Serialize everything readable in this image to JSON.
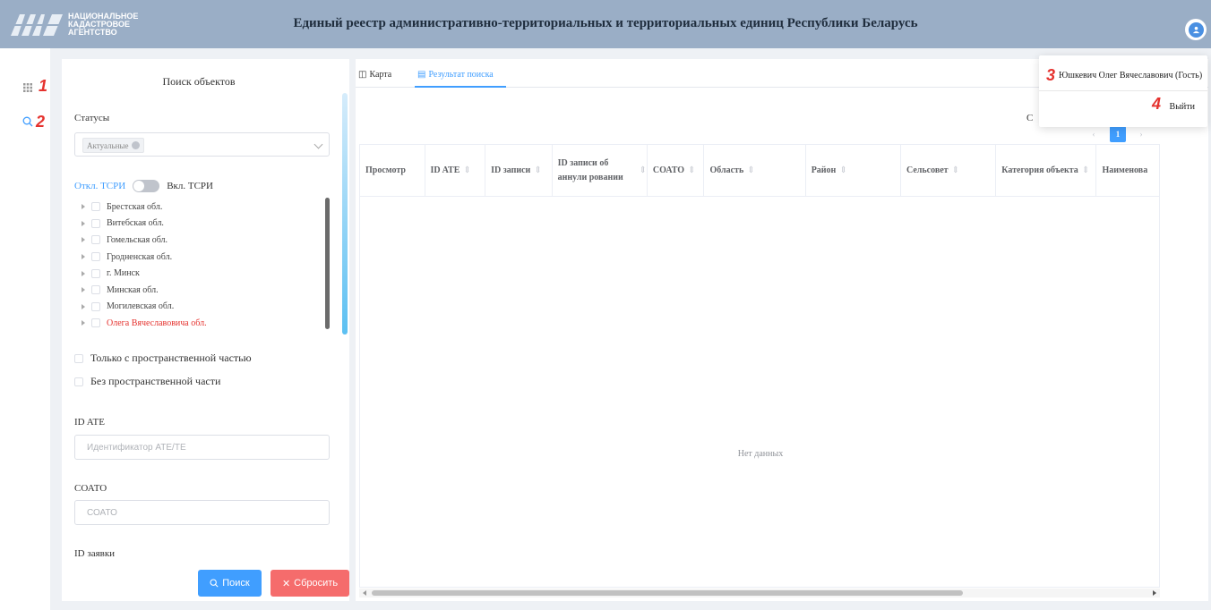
{
  "header": {
    "logo_lines": [
      "НАЦИОНАЛЬНОЕ",
      "КАДАСТРОВОЕ",
      "АГЕНТСТВО"
    ],
    "title": "Единый реестр административно-территориальных и территориальных единиц Республики Беларусь"
  },
  "rail": {
    "items": [
      {
        "icon": "grid-icon",
        "badge": "1"
      },
      {
        "icon": "search-icon",
        "badge": "2"
      }
    ]
  },
  "search_panel": {
    "title": "Поиск объектов",
    "statuses_label": "Статусы",
    "status_tag": "Актуальные",
    "tsr_off": "Откл. ТСРИ",
    "tsr_on": "Вкл. ТСРИ",
    "regions": [
      "Брестская обл.",
      "Витебская обл.",
      "Гомельская обл.",
      "Гродненская обл.",
      "г. Минск",
      "Минская обл.",
      "Могилевская обл.",
      "Олега Вячеславовича обл."
    ],
    "only_spatial": "Только с пространственной частью",
    "without_spatial": "Без пространственной части",
    "id_ate_label": "ID ATE",
    "id_ate_placeholder": "Идентификатор АТЕ/ТЕ",
    "soato_label": "СОАТО",
    "soato_placeholder": "СОАТО",
    "id_request_label": "ID заявки",
    "search_button": "Поиск",
    "reset_button": "Сбросить"
  },
  "tabs": {
    "map": "Карта",
    "results": "Результат поиска"
  },
  "results": {
    "pager_text": "С",
    "current_page": "1",
    "columns": [
      "Просмотр",
      "ID ATE",
      "ID записи",
      "ID записи об аннули ровании",
      "СОАТО",
      "Область",
      "Район",
      "Сельсовет",
      "Категория объекта",
      "Наименова"
    ],
    "empty_text": "Нет данных"
  },
  "user_menu": {
    "user": "Юшкевич Олег Вячеславович (Гость)",
    "badge_user": "3",
    "logout": "Выйти",
    "badge_logout": "4"
  },
  "colors": {
    "header_bg": "#9aaec6",
    "accent": "#409eff",
    "danger": "#f56c6c",
    "annotation": "#e5322e"
  }
}
